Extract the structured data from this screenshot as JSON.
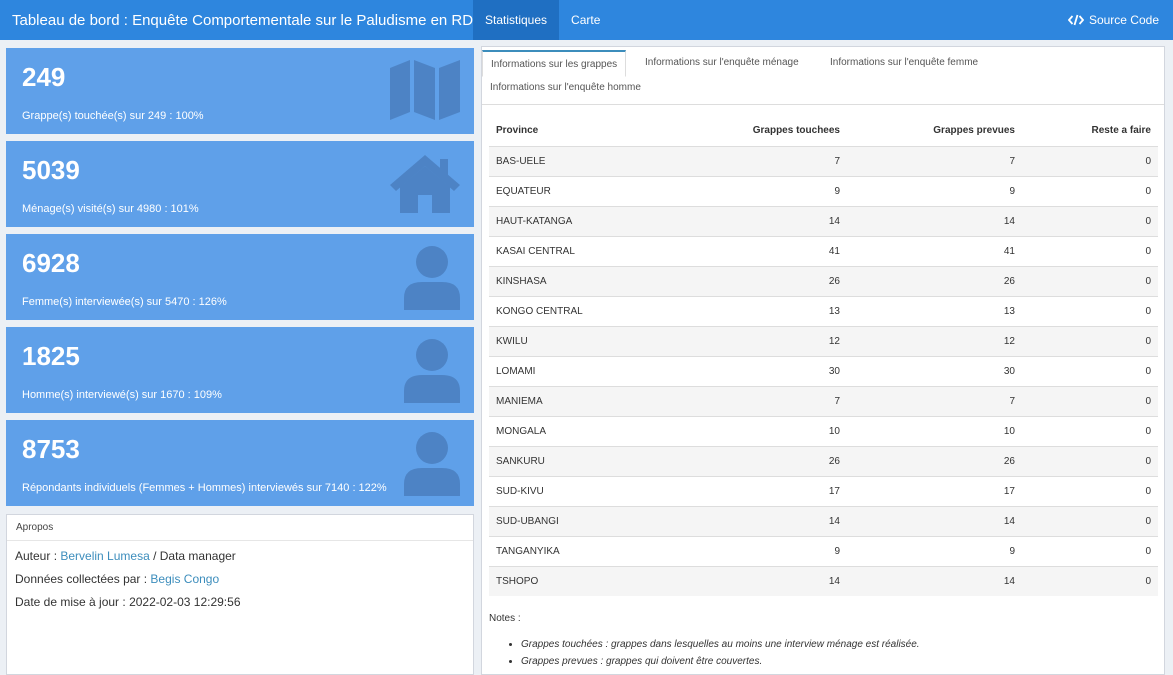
{
  "navbar": {
    "title": "Tableau de bord : Enquête Comportementale sur le Paludisme en RDC",
    "tabs": [
      "Statistiques",
      "Carte"
    ],
    "source_code": "Source Code"
  },
  "value_boxes": [
    {
      "value": "249",
      "subtitle": "Grappe(s) touchée(s) sur 249 : 100%",
      "icon": "map-icon"
    },
    {
      "value": "5039",
      "subtitle": "Ménage(s) visité(s) sur 4980 : 101%",
      "icon": "home-icon"
    },
    {
      "value": "6928",
      "subtitle": "Femme(s) interviewée(s) sur 5470 : 126%",
      "icon": "user-icon"
    },
    {
      "value": "1825",
      "subtitle": "Homme(s) interviewé(s) sur 1670 : 109%",
      "icon": "user-icon"
    },
    {
      "value": "8753",
      "subtitle": "Répondants individuels (Femmes + Hommes) interviewés sur 7140 : 122%",
      "icon": "user-icon"
    }
  ],
  "apropos": {
    "header": "Apropos",
    "author_label": "Auteur : ",
    "author_name": "Bervelin Lumesa",
    "author_role": " / Data manager",
    "collected_label": "Données collectées par : ",
    "collected_by": "Begis Congo",
    "updated_label": "Date de mise à jour : ",
    "updated_value": "2022-02-03 12:29:56"
  },
  "panel_tabs": [
    "Informations sur les grappes",
    "Informations sur l'enquête ménage",
    "Informations sur l'enquête femme",
    "Informations sur l'enquête homme"
  ],
  "table": {
    "headers": [
      "Province",
      "Grappes touchees",
      "Grappes prevues",
      "Reste a faire"
    ],
    "rows": [
      [
        "BAS-UELE",
        "7",
        "7",
        "0"
      ],
      [
        "EQUATEUR",
        "9",
        "9",
        "0"
      ],
      [
        "HAUT-KATANGA",
        "14",
        "14",
        "0"
      ],
      [
        "KASAI CENTRAL",
        "41",
        "41",
        "0"
      ],
      [
        "KINSHASA",
        "26",
        "26",
        "0"
      ],
      [
        "KONGO CENTRAL",
        "13",
        "13",
        "0"
      ],
      [
        "KWILU",
        "12",
        "12",
        "0"
      ],
      [
        "LOMAMI",
        "30",
        "30",
        "0"
      ],
      [
        "MANIEMA",
        "7",
        "7",
        "0"
      ],
      [
        "MONGALA",
        "10",
        "10",
        "0"
      ],
      [
        "SANKURU",
        "26",
        "26",
        "0"
      ],
      [
        "SUD-KIVU",
        "17",
        "17",
        "0"
      ],
      [
        "SUD-UBANGI",
        "14",
        "14",
        "0"
      ],
      [
        "TANGANYIKA",
        "9",
        "9",
        "0"
      ],
      [
        "TSHOPO",
        "14",
        "14",
        "0"
      ]
    ]
  },
  "notes": {
    "title": "Notes :",
    "items": [
      "Grappes touchées : grappes dans lesquelles au moins une interview ménage est réalisée.",
      "Grappes prevues : grappes qui doivent être couvertes."
    ]
  },
  "colors": {
    "navbar": "#2e86de",
    "value_box": "#5fa0e9",
    "link": "#3c8dbc"
  }
}
